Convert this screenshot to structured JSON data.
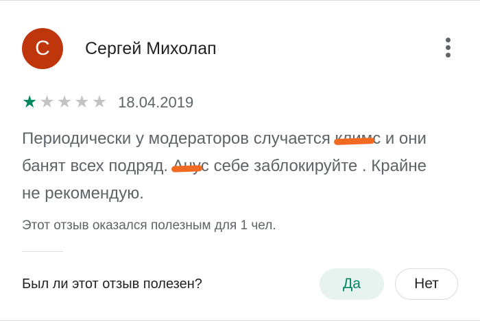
{
  "review": {
    "avatar_letter": "С",
    "avatar_color": "#bf360c",
    "author": "Сергей Михолап",
    "more_icon": "more-vert-icon",
    "rating": 1,
    "rating_max": 5,
    "star_filled_color": "#01875f",
    "star_empty_color": "#c3c3c3",
    "date": "18.04.2019",
    "text": {
      "part1": "Периодически у модераторов случается",
      "redacted1": "клим",
      "part2": "с и они банят всех подряд. ",
      "redacted2": "Ану",
      "part3": "с себе заблокируйте . Крайне не рекомендую."
    },
    "helpful_count_text": "Этот отзыв оказался полезным для 1 чел."
  },
  "feedback": {
    "question": "Был ли этот отзыв полезен?",
    "yes_label": "Да",
    "no_label": "Нет",
    "accent_color": "#01875f"
  }
}
